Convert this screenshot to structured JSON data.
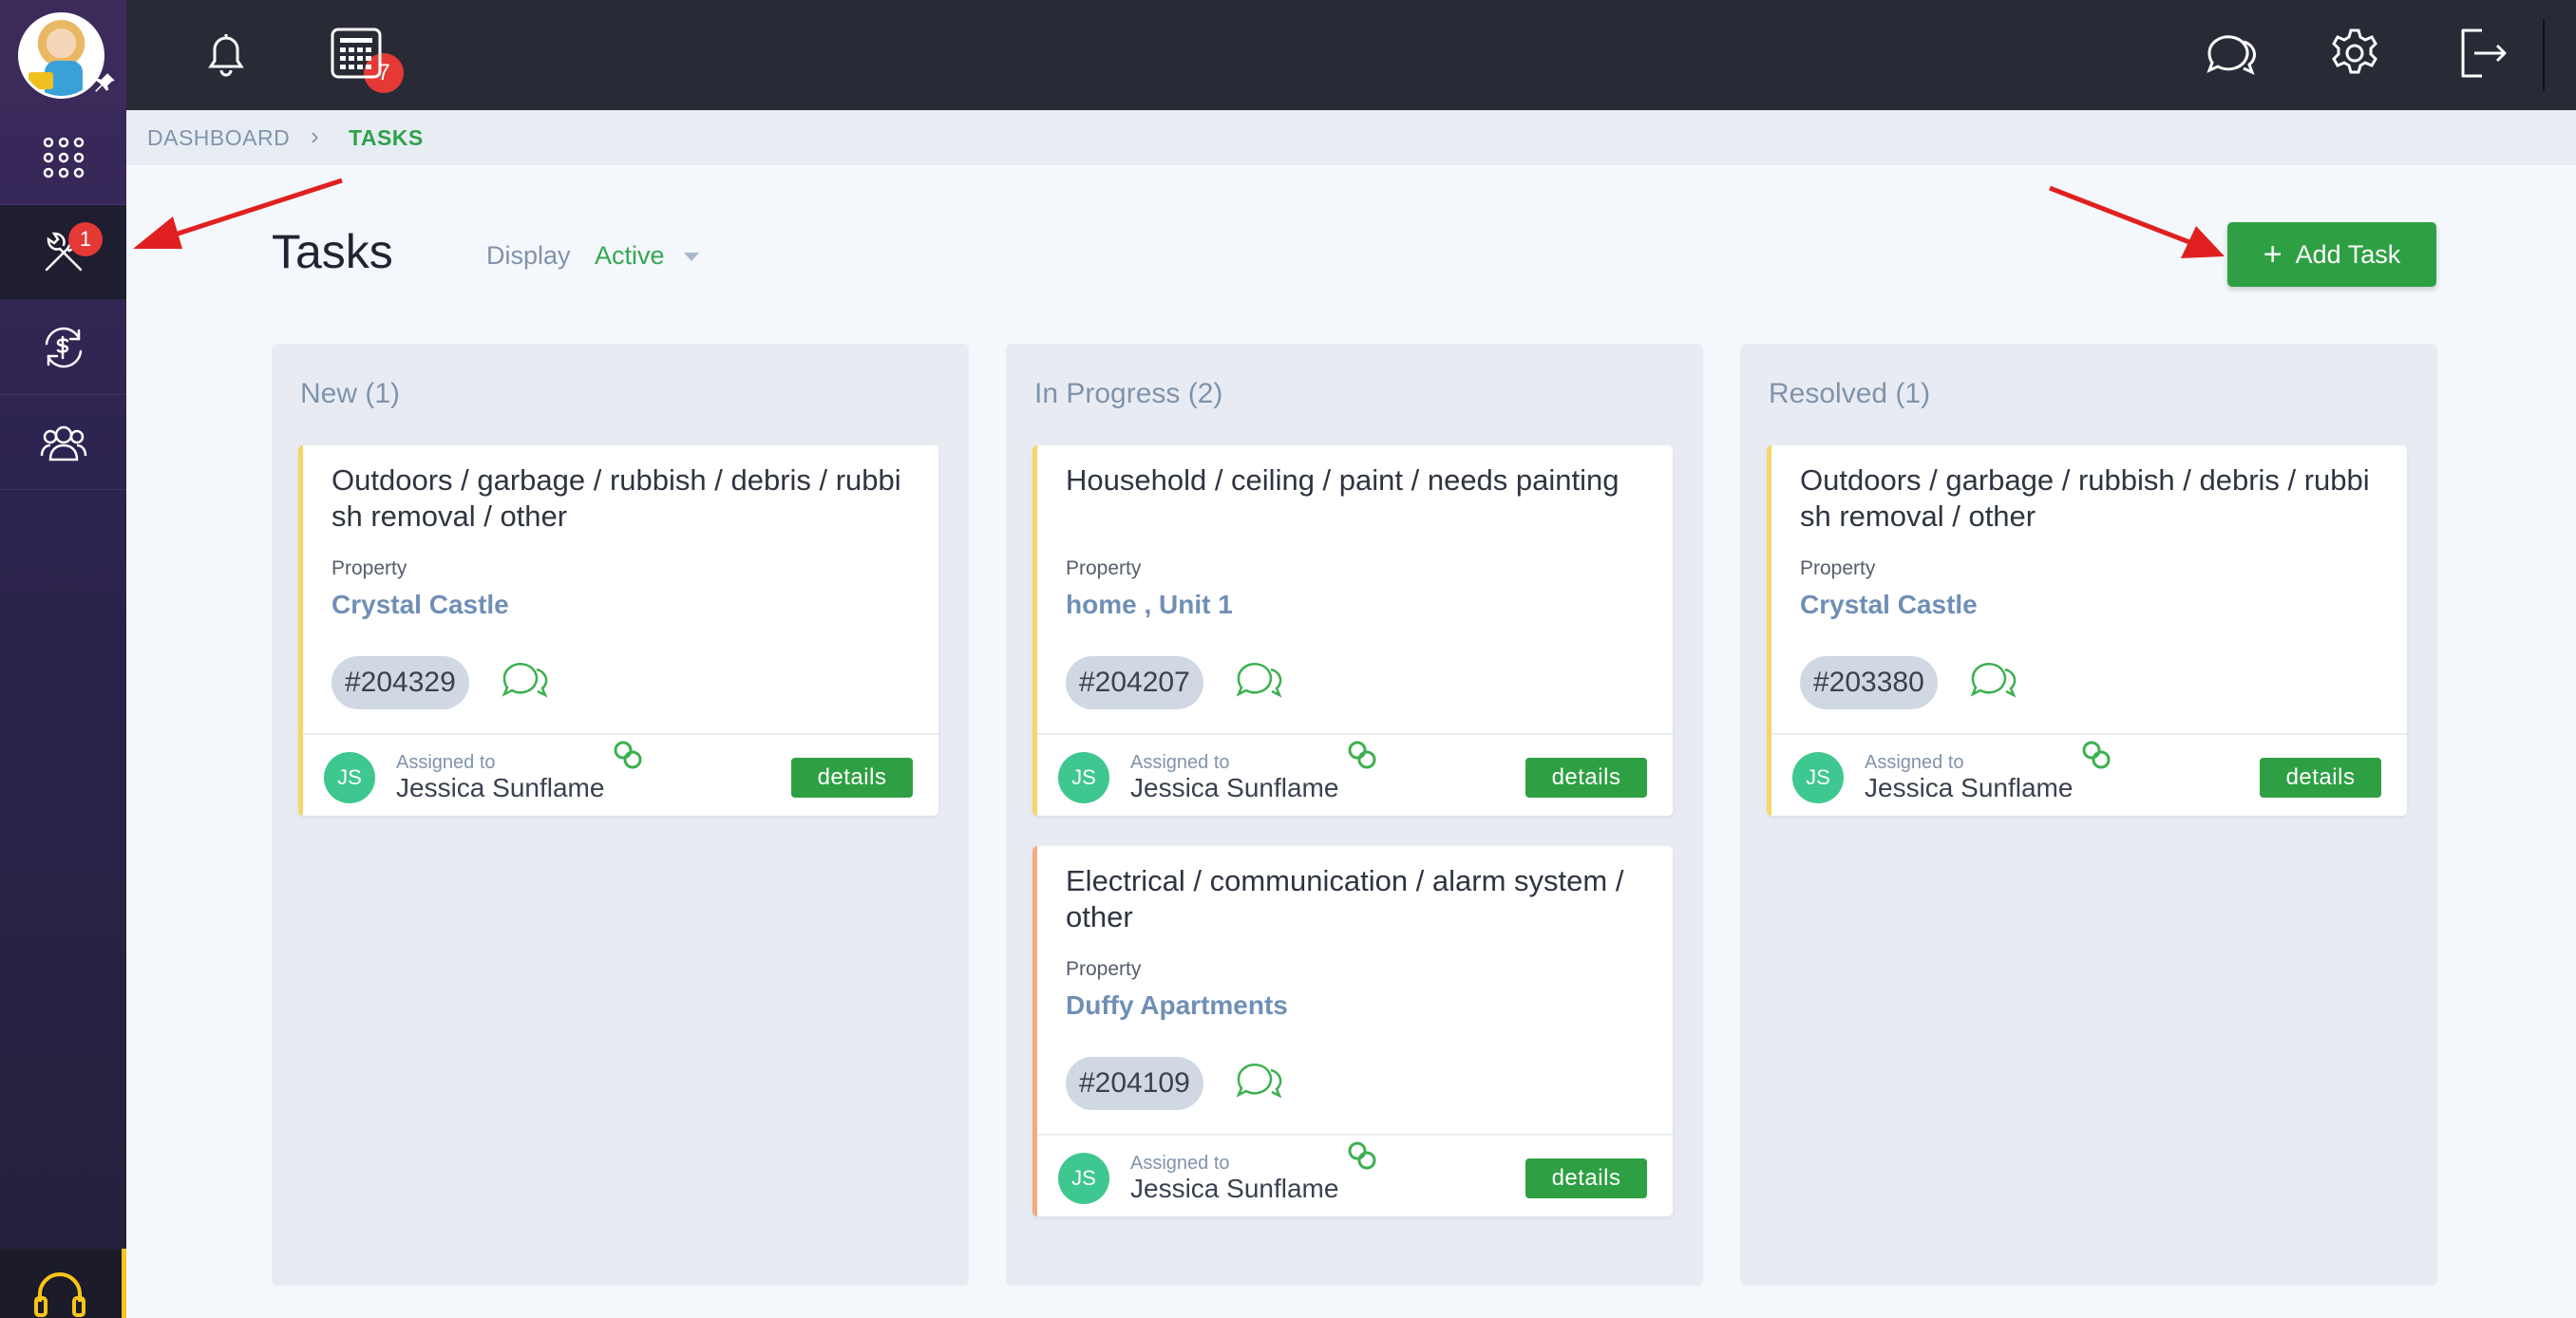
{
  "topbar": {
    "notifications_count": "7",
    "icons": [
      "bell-icon",
      "calendar-icon",
      "chat-icon",
      "gear-icon",
      "logout-icon"
    ]
  },
  "sidebar": {
    "items": [
      {
        "icon": "apps-grid-icon"
      },
      {
        "icon": "tools-icon",
        "badge": "1",
        "active": true
      },
      {
        "icon": "money-exchange-icon"
      },
      {
        "icon": "users-icon"
      }
    ],
    "support_icon": "headset-icon"
  },
  "breadcrumb": {
    "items": [
      "DASHBOARD",
      "TASKS"
    ],
    "separator": "›"
  },
  "header": {
    "title": "Tasks",
    "display_label": "Display",
    "display_value": "Active",
    "add_button": "Add Task"
  },
  "columns": [
    {
      "title": "New (1)",
      "cards": [
        {
          "title": "Outdoors / garbage / rubbish / debris / rubbish removal / other",
          "property_label": "Property",
          "property": "Crystal Castle",
          "id": "#204329",
          "assigned_label": "Assigned to",
          "assignee": "Jessica Sunflame",
          "initials": "JS",
          "details": "details"
        }
      ]
    },
    {
      "title": "In Progress (2)",
      "cards": [
        {
          "title": "Household / ceiling / paint / needs painting",
          "property_label": "Property",
          "property": "home , Unit 1",
          "id": "#204207",
          "assigned_label": "Assigned to",
          "assignee": "Jessica Sunflame",
          "initials": "JS",
          "details": "details"
        },
        {
          "title": "Electrical / communication / alarm system / other",
          "property_label": "Property",
          "property": "Duffy Apartments",
          "id": "#204109",
          "assigned_label": "Assigned to",
          "assignee": "Jessica Sunflame",
          "initials": "JS",
          "details": "details"
        }
      ]
    },
    {
      "title": "Resolved (1)",
      "cards": [
        {
          "title": "Outdoors / garbage / rubbish / debris / rubbish removal / other",
          "property_label": "Property",
          "property": "Crystal Castle",
          "id": "#203380",
          "assigned_label": "Assigned to",
          "assignee": "Jessica Sunflame",
          "initials": "JS",
          "details": "details"
        }
      ]
    }
  ],
  "colors": {
    "accent_green": "#2ea043",
    "card_new": "#f6d56a",
    "card_high": "#f4ab80",
    "badge_red": "#e53935",
    "annotation_arrow": "#e02020"
  }
}
